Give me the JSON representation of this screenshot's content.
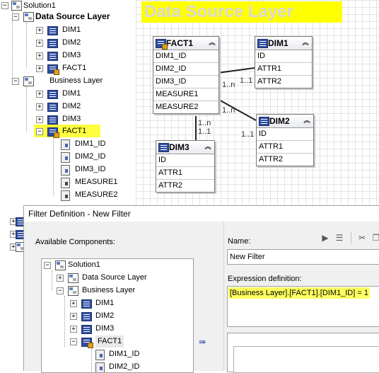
{
  "tree": {
    "solution": "Solution1",
    "data_source_layer": "Data Source Layer",
    "ds_items": [
      "DIM1",
      "DIM2",
      "DIM3",
      "FACT1"
    ],
    "business_layer": "Business Layer",
    "bl_items": [
      "DIM1",
      "DIM2",
      "DIM3"
    ],
    "fact_selected": "FACT1",
    "fact_columns": [
      "DIM1_ID",
      "DIM2_ID",
      "DIM3_ID",
      "MEASURE1",
      "MEASURE2"
    ]
  },
  "canvas": {
    "layer_title": "Data Source Layer",
    "highlight_color": "#ffff00",
    "entities": {
      "fact1": {
        "name": "FACT1",
        "rows": [
          "DIM1_ID",
          "DIM2_ID",
          "DIM3_ID",
          "MEASURE1",
          "MEASURE2"
        ]
      },
      "dim1": {
        "name": "DIM1",
        "rows": [
          "ID",
          "ATTR1",
          "ATTR2"
        ]
      },
      "dim2": {
        "name": "DIM2",
        "rows": [
          "ID",
          "ATTR1",
          "ATTR2"
        ]
      },
      "dim3": {
        "name": "DIM3",
        "rows": [
          "ID",
          "ATTR1",
          "ATTR2"
        ]
      }
    },
    "cardinality": {
      "f_d1_many": "1..n",
      "f_d1_one": "1..1",
      "f_d2_many": "1..n",
      "f_d2_one": "1..1",
      "f_d3_many": "1..n",
      "f_d3_one": "1..1"
    }
  },
  "dialog": {
    "title": "Filter Definition - New Filter",
    "available_label": "Available Components:",
    "name_label": "Name:",
    "name_value": "New Filter",
    "expr_label": "Expression definition:",
    "expr_value": "[Business Layer].[FACT1].[DIM1_ID] = 1",
    "tree": {
      "solution": "Solution1",
      "data_source_layer": "Data Source Layer",
      "business_layer": "Business Layer",
      "bl_items": [
        "DIM1",
        "DIM2",
        "DIM3"
      ],
      "fact": "FACT1",
      "fact_columns": [
        "DIM1_ID",
        "DIM2_ID"
      ]
    },
    "move_icon": "double-arrow-right-icon"
  }
}
